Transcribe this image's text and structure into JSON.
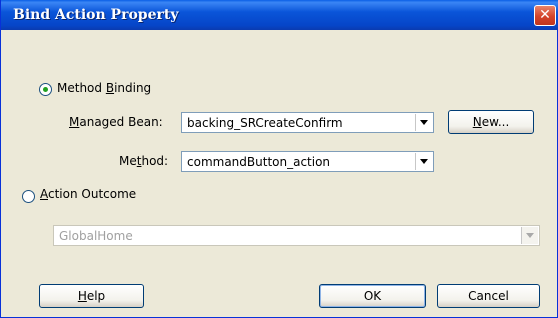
{
  "dialog": {
    "title": "Bind Action Property",
    "close_glyph": "✕"
  },
  "method_binding": {
    "label_pre": "Method ",
    "label_mnemonic": "B",
    "label_post": "inding",
    "selected": true
  },
  "managed_bean": {
    "label_mnemonic": "M",
    "label_post": "anaged Bean:",
    "value": "backing_SRCreateConfirm"
  },
  "new_button": {
    "label_mnemonic": "N",
    "label_post": "ew..."
  },
  "method": {
    "label_pre": "Me",
    "label_mnemonic": "t",
    "label_post": "hod:",
    "value": "commandButton_action"
  },
  "action_outcome": {
    "label_mnemonic": "A",
    "label_post": "ction Outcome",
    "selected": false,
    "value": "GlobalHome"
  },
  "buttons": {
    "help_mnemonic": "H",
    "help_post": "elp",
    "ok": "OK",
    "cancel": "Cancel"
  }
}
